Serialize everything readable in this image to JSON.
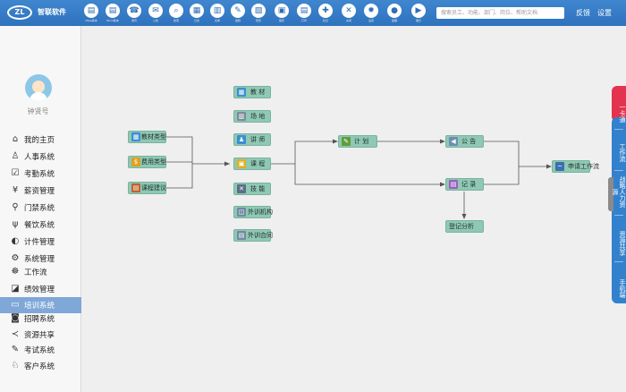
{
  "app": {
    "name": "智联软件",
    "logo_text": "ZL"
  },
  "toolbar": [
    {
      "label": "iWeb版本",
      "icon": "doc-icon",
      "glyph": "▤"
    },
    {
      "label": "Word版本",
      "icon": "doc-icon",
      "glyph": "▤"
    },
    {
      "label": "通讯",
      "icon": "contacts-icon",
      "glyph": "☎"
    },
    {
      "label": "公告",
      "icon": "mail-icon",
      "glyph": "✉"
    },
    {
      "label": "搜索",
      "icon": "search-icon",
      "glyph": "⌕"
    },
    {
      "label": "日志",
      "icon": "doc-icon",
      "glyph": "▦"
    },
    {
      "label": "表单",
      "icon": "doc-icon",
      "glyph": "▥"
    },
    {
      "label": "编辑",
      "icon": "pencil-icon",
      "glyph": "✎"
    },
    {
      "label": "预览",
      "icon": "page-icon",
      "glyph": "▧"
    },
    {
      "label": "保存",
      "icon": "save-icon",
      "glyph": "▣"
    },
    {
      "label": "打印",
      "icon": "print-icon",
      "glyph": "▤"
    },
    {
      "label": "标记",
      "icon": "pin-icon",
      "glyph": "✚"
    },
    {
      "label": "关闭",
      "icon": "close-icon",
      "glyph": "✕"
    },
    {
      "label": "设置",
      "icon": "gear-icon",
      "glyph": "✹"
    },
    {
      "label": "提醒",
      "icon": "bulb-icon",
      "glyph": "●"
    },
    {
      "label": "展示",
      "icon": "play-icon",
      "glyph": "▶"
    }
  ],
  "search": {
    "placeholder": "搜索员工、功能、部门、岗位、帮助文档"
  },
  "top_links": {
    "feedback": "反馈",
    "settings": "设置"
  },
  "user": {
    "name": "钟贤号"
  },
  "menu": [
    {
      "label": "我的主页",
      "icon": "home-icon",
      "glyph": "⌂",
      "active": false
    },
    {
      "label": "人事系统",
      "icon": "person-icon",
      "glyph": "♙",
      "active": false
    },
    {
      "label": "考勤系统",
      "icon": "calendar-icon",
      "glyph": "☑",
      "active": false
    },
    {
      "label": "薪资管理",
      "icon": "money-icon",
      "glyph": "¥",
      "active": false
    },
    {
      "label": "门禁系统",
      "icon": "door-icon",
      "glyph": "⚲",
      "active": false
    },
    {
      "label": "餐饮系统",
      "icon": "dining-icon",
      "glyph": "ψ",
      "active": false
    },
    {
      "label": "计件管理",
      "icon": "piece-icon",
      "glyph": "◐",
      "active": false
    },
    {
      "label": "系统管理",
      "icon": "settings-icon",
      "glyph": "⚙",
      "active": false
    },
    {
      "label": "工作流",
      "icon": "workflow-icon",
      "glyph": "☸",
      "active": false
    },
    {
      "label": "绩效管理",
      "icon": "chart-icon",
      "glyph": "◪",
      "active": false
    },
    {
      "label": "培训系统",
      "icon": "training-icon",
      "glyph": "▭",
      "active": true
    },
    {
      "label": "招聘系统",
      "icon": "recruit-icon",
      "glyph": "◙",
      "active": false
    },
    {
      "label": "资源共享",
      "icon": "share-icon",
      "glyph": "≺",
      "active": false
    },
    {
      "label": "考试系统",
      "icon": "exam-icon",
      "glyph": "✎",
      "active": false
    },
    {
      "label": "客户系统",
      "icon": "client-icon",
      "glyph": "♘",
      "active": false
    }
  ],
  "flow": {
    "types": [
      {
        "label": "教材类型",
        "icon": "book-icon",
        "color": "#3a8fd0",
        "glyph": "▦"
      },
      {
        "label": "费用类型",
        "icon": "coin-icon",
        "color": "#e0a020",
        "glyph": "$"
      },
      {
        "label": "课程建议",
        "icon": "note-icon",
        "color": "#c0622d",
        "glyph": "▤"
      }
    ],
    "resources": [
      {
        "label": "教 材",
        "icon": "book-icon",
        "color": "#3a8fd0",
        "glyph": "▦"
      },
      {
        "label": "场 地",
        "icon": "building-icon",
        "color": "#7d8b99",
        "glyph": "▥"
      },
      {
        "label": "讲 师",
        "icon": "teacher-icon",
        "color": "#3a8fd0",
        "glyph": "♟"
      },
      {
        "label": "课 程",
        "icon": "course-icon",
        "color": "#e0b020",
        "glyph": "▣"
      },
      {
        "label": "技 能",
        "icon": "tools-icon",
        "color": "#5a6f86",
        "glyph": "✕"
      },
      {
        "label": "外训机构",
        "icon": "org-icon",
        "color": "#6f8aa0",
        "glyph": "◫"
      },
      {
        "label": "外训合同",
        "icon": "contract-icon",
        "color": "#6f8aa0",
        "glyph": "▤"
      }
    ],
    "plan": {
      "label": "计 划",
      "icon": "plan-icon",
      "color": "#5f9d3a",
      "glyph": "✎"
    },
    "notice": {
      "label": "公 告",
      "icon": "notice-icon",
      "color": "#6b8fb0",
      "glyph": "◀"
    },
    "record": {
      "label": "记 录",
      "icon": "record-icon",
      "color": "#9b5fc0",
      "glyph": "▤"
    },
    "analysis": {
      "label": "登记分析"
    },
    "apply": {
      "label": "申请工作流",
      "icon": "apply-icon",
      "color": "#3a6fb0",
      "glyph": "~"
    }
  },
  "right_tabs": [
    {
      "label": "一卡通"
    },
    {
      "label": "工作流"
    },
    {
      "label": "战略人力资源"
    },
    {
      "label": "资源共享"
    },
    {
      "label": "手机端"
    }
  ]
}
